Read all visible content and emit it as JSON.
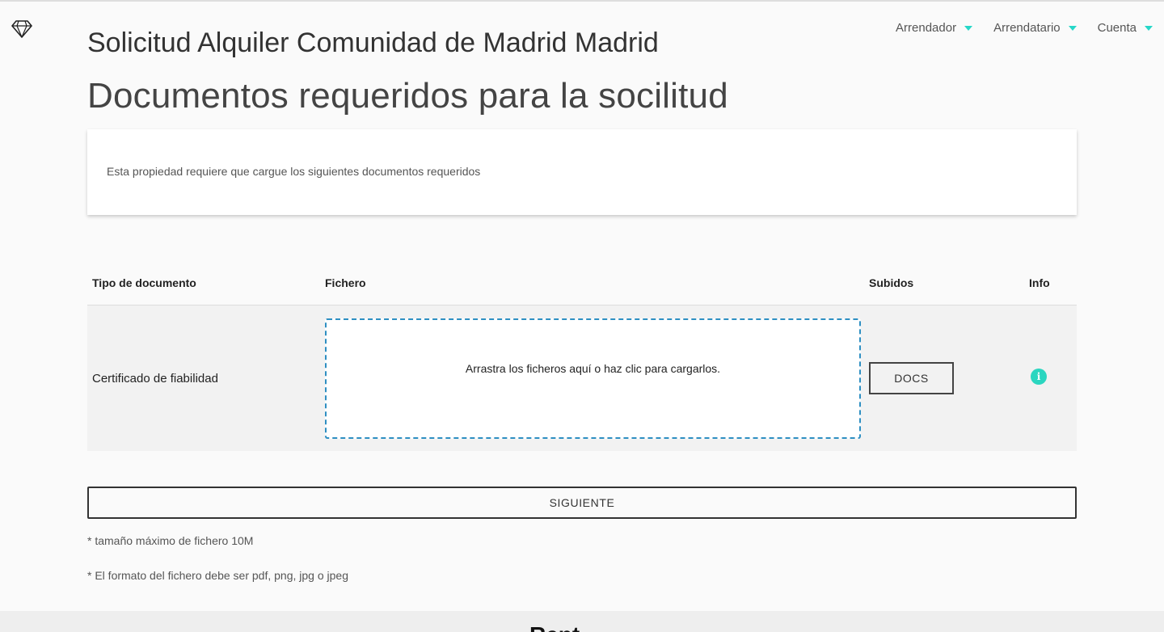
{
  "logo": {
    "icon": "diamond-icon"
  },
  "nav": {
    "items": [
      {
        "label": "Arrendador"
      },
      {
        "label": "Arrendatario"
      },
      {
        "label": "Cuenta"
      }
    ],
    "accent": "#26d7c8"
  },
  "header": {
    "title": "Solicitud Alquiler Comunidad de Madrid Madrid",
    "subtitle": "Documentos requeridos para la socilitud"
  },
  "info_card": {
    "text": "Esta propiedad requiere que cargue los siguientes documentos requeridos"
  },
  "table": {
    "columns": [
      "Tipo de documento",
      "Fichero",
      "Subidos",
      "Info"
    ],
    "rows": [
      {
        "document_type": "Certificado de fiabilidad",
        "dropzone_text": "Arrastra los ficheros aquí o haz clic para cargarlos.",
        "uploaded_button": "DOCS",
        "info_icon": "info-icon"
      }
    ]
  },
  "actions": {
    "next_label": "SIGUIENTE"
  },
  "notes": [
    "* tamaño máximo de fichero 10M",
    "* El formato del fichero debe ser pdf, png, jpg o jpeg"
  ],
  "footer": {
    "brand_partial": "Rent"
  },
  "colors": {
    "accent": "#26d7c8",
    "dropzone_border": "#2e8fc2",
    "info_icon": "#2bd6c0"
  }
}
